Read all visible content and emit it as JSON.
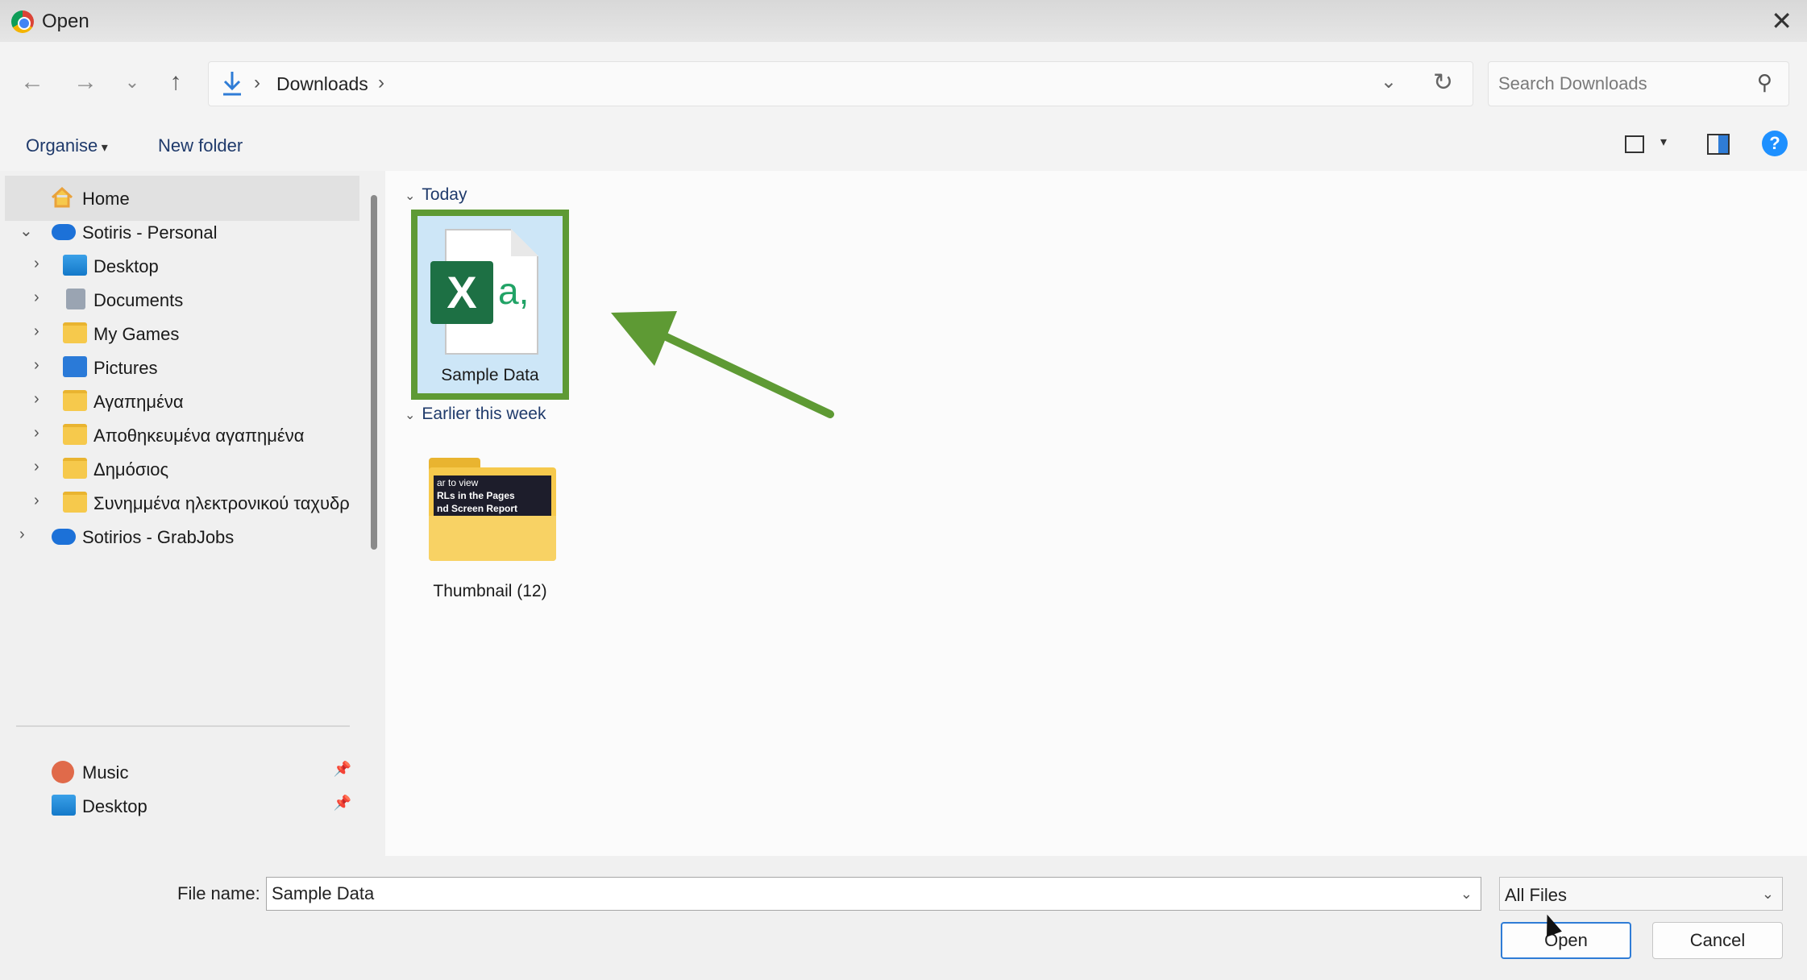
{
  "window": {
    "title": "Open",
    "close_icon": "close-icon"
  },
  "nav": {
    "back_icon": "arrow-left-icon",
    "forward_icon": "arrow-right-icon",
    "recent_icon": "chevron-down-icon",
    "up_icon": "arrow-up-icon",
    "breadcrumb": [
      "Downloads"
    ],
    "search_placeholder": "Search Downloads"
  },
  "commands": {
    "organise": "Organise",
    "new_folder": "New folder"
  },
  "sidebar": {
    "items": [
      {
        "label": "Home",
        "icon": "home-icon",
        "selected": true
      },
      {
        "label": "Sotiris - Personal",
        "icon": "cloud-icon",
        "expanded": true
      },
      {
        "label": "Desktop",
        "icon": "desktop-folder-icon"
      },
      {
        "label": "Documents",
        "icon": "documents-folder-icon"
      },
      {
        "label": "My Games",
        "icon": "folder-icon"
      },
      {
        "label": "Pictures",
        "icon": "pictures-folder-icon"
      },
      {
        "label": "Αγαπημένα",
        "icon": "folder-icon"
      },
      {
        "label": "Αποθηκευμένα αγαπημένα",
        "icon": "folder-icon"
      },
      {
        "label": "Δημόσιος",
        "icon": "folder-icon"
      },
      {
        "label": "Συνημμένα ηλεκτρονικού ταχυδρ",
        "icon": "folder-icon"
      },
      {
        "label": "Sotirios - GrabJobs",
        "icon": "cloud-icon"
      }
    ],
    "quick_access": [
      {
        "label": "Music",
        "icon": "music-icon",
        "pinned": true
      },
      {
        "label": "Desktop",
        "icon": "desktop-folder-icon",
        "pinned": true
      }
    ]
  },
  "content": {
    "groups": [
      {
        "header": "Today",
        "files": [
          {
            "name": "Sample Data",
            "icon": "excel-csv-icon",
            "selected": true
          }
        ]
      },
      {
        "header": "Earlier this week",
        "files": [
          {
            "name": "Thumbnail (12)",
            "icon": "folder-thumbnail-icon",
            "preview_text": [
              "ar to view",
              "RLs in the Pages",
              "nd Screen Report"
            ]
          }
        ]
      }
    ]
  },
  "footer": {
    "file_name_label": "File name:",
    "file_name_value": "Sample Data",
    "file_type": "All Files",
    "open_label": "Open",
    "cancel_label": "Cancel"
  },
  "colors": {
    "highlight": "#5e9a34",
    "accent": "#2f7cd6",
    "excel": "#1d7044"
  }
}
